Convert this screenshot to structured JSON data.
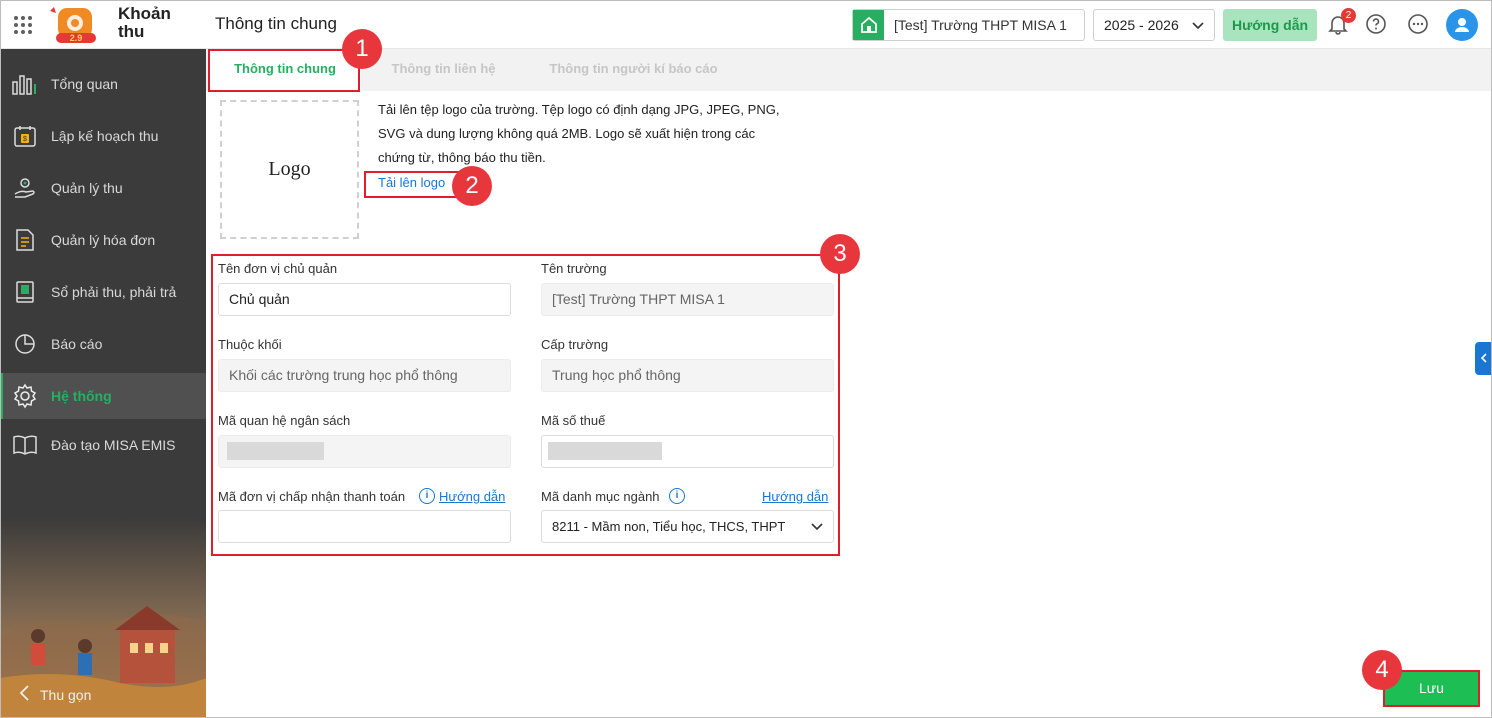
{
  "header": {
    "app_name": "Khoản thu",
    "page_title": "Thông tin chung",
    "school": "[Test] Trường THPT MISA 1",
    "year": "2025 - 2026",
    "guide_button": "Hướng dẫn",
    "notification_count": "2"
  },
  "sidebar": {
    "items": [
      {
        "label": "Tổng quan",
        "icon": "chart-bars-icon"
      },
      {
        "label": "Lập kế hoạch thu",
        "icon": "calendar-money-icon"
      },
      {
        "label": "Quản lý thu",
        "icon": "hand-coin-icon"
      },
      {
        "label": "Quản lý hóa đơn",
        "icon": "invoice-icon"
      },
      {
        "label": "Sổ phải thu, phải trả",
        "icon": "ledger-book-icon"
      },
      {
        "label": "Báo cáo",
        "icon": "pie-chart-icon"
      },
      {
        "label": "Hệ thống",
        "icon": "gear-icon"
      },
      {
        "label": "Đào tạo MISA EMIS",
        "icon": "open-book-icon"
      }
    ],
    "active_index": 6,
    "collapse_label": "Thu gọn"
  },
  "tabs": [
    "Thông tin chung",
    "Thông tin liên hệ",
    "Thông tin người kí báo cáo"
  ],
  "logo": {
    "placeholder": "Logo",
    "description": "Tải lên tệp logo của trường. Tệp logo có định dạng JPG, JPEG, PNG, SVG và dung lượng không quá 2MB. Logo sẽ xuất hiện trong các chứng từ, thông báo thu tiền.",
    "upload_link": "Tải lên logo"
  },
  "form": {
    "owner_label": "Tên đơn vị chủ quản",
    "owner_value": "Chủ quản",
    "school_label": "Tên trường",
    "school_value": "[Test] Trường THPT MISA 1",
    "block_label": "Thuộc khối",
    "block_value": "Khối các trường trung học phổ thông",
    "level_label": "Cấp trường",
    "level_value": "Trung học phổ thông",
    "budget_label": "Mã quan hệ ngân sách",
    "tax_label": "Mã số thuế",
    "payment_label": "Mã đơn vị chấp nhận thanh toán",
    "payment_guide": "Hướng dẫn",
    "industry_label": "Mã danh mục ngành",
    "industry_guide": "Hướng dẫn",
    "industry_value": "8211 - Mầm non, Tiểu học, THCS, THPT"
  },
  "annotations": [
    "1",
    "2",
    "3",
    "4"
  ],
  "save_button": "Lưu",
  "colors": {
    "accent": "#27ae60",
    "annotation": "#e01e2b",
    "link": "#1976d2",
    "sidebar": "#3b3b3b"
  }
}
